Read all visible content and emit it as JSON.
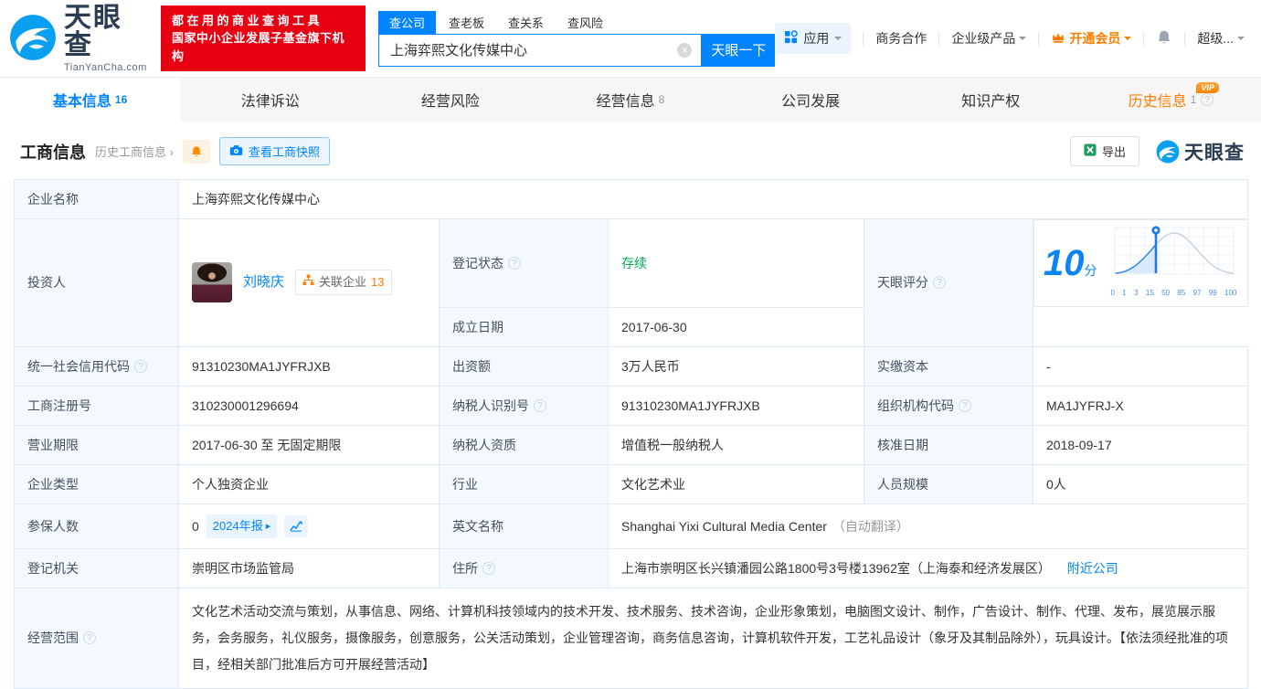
{
  "icons": {
    "help": "?",
    "clear": "×",
    "chevron": "›",
    "report_arrow": "▸"
  },
  "brand": {
    "name_cn": "天眼查",
    "domain": "TianYanCha.com",
    "banner_line1": "都在用的商业查询工具",
    "banner_line2": "国家中小企业发展子基金旗下机构"
  },
  "search": {
    "tabs": [
      {
        "label": "查公司"
      },
      {
        "label": "查老板"
      },
      {
        "label": "查关系"
      },
      {
        "label": "查风险"
      }
    ],
    "value": "上海弈熙文化传媒中心",
    "submit_label": "天眼一下"
  },
  "topnav": {
    "apps": "应用",
    "cooperation": "商务合作",
    "enterprise_products": "企业级产品",
    "vip": "开通会员",
    "account": "超级..."
  },
  "page_tabs": [
    {
      "label": "基本信息",
      "count": "16"
    },
    {
      "label": "法律诉讼",
      "count": ""
    },
    {
      "label": "经营风险",
      "count": ""
    },
    {
      "label": "经营信息",
      "count": "8"
    },
    {
      "label": "公司发展",
      "count": ""
    },
    {
      "label": "知识产权",
      "count": ""
    },
    {
      "label": "历史信息",
      "count": "1",
      "vip_badge": "VIP"
    }
  ],
  "section": {
    "title": "工商信息",
    "history_link": "历史工商信息",
    "snapshot_button": "查看工商快照",
    "export_button": "导出",
    "watermark": "天眼查"
  },
  "info": {
    "company_name": {
      "label": "企业名称",
      "value": "上海弈熙文化传媒中心"
    },
    "investor": {
      "label": "投资人",
      "name": "刘晓庆",
      "related_label": "关联企业",
      "related_count": "13"
    },
    "reg_status": {
      "label": "登记状态",
      "value": "存续"
    },
    "establish_date": {
      "label": "成立日期",
      "value": "2017-06-30"
    },
    "score": {
      "label": "天眼评分",
      "value": "10",
      "unit": "分"
    },
    "credit_code": {
      "label": "统一社会信用代码",
      "value": "91310230MA1JYFRJXB"
    },
    "capital": {
      "label": "出资额",
      "value": "3万人民币"
    },
    "paid_in_capital": {
      "label": "实缴资本",
      "value": "-"
    },
    "reg_number": {
      "label": "工商注册号",
      "value": "310230001296694"
    },
    "taxpayer_id": {
      "label": "纳税人识别号",
      "value": "91310230MA1JYFRJXB"
    },
    "org_code": {
      "label": "组织机构代码",
      "value": "MA1JYFRJ-X"
    },
    "business_term": {
      "label": "营业期限",
      "value": "2017-06-30 至 无固定期限"
    },
    "taxpayer_quality": {
      "label": "纳税人资质",
      "value": "增值税一般纳税人"
    },
    "approve_date": {
      "label": "核准日期",
      "value": "2018-09-17"
    },
    "company_type": {
      "label": "企业类型",
      "value": "个人独资企业"
    },
    "industry": {
      "label": "行业",
      "value": "文化艺术业"
    },
    "staff_size": {
      "label": "人员规模",
      "value": "0人"
    },
    "insured_count": {
      "label": "参保人数",
      "value": "0",
      "report_badge": "2024年报"
    },
    "english_name": {
      "label": "英文名称",
      "value": "Shanghai Yixi Cultural Media Center",
      "note": "（自动翻译）"
    },
    "reg_authority": {
      "label": "登记机关",
      "value": "崇明区市场监管局"
    },
    "address": {
      "label": "住所",
      "value": "上海市崇明区长兴镇潘园公路1800号3号楼13962室（上海泰和经济发展区）",
      "nearby_link": "附近公司"
    },
    "business_scope": {
      "label": "经营范围",
      "value": "文化艺术活动交流与策划，从事信息、网络、计算机科技领域内的技术开发、技术服务、技术咨询，企业形象策划，电脑图文设计、制作，广告设计、制作、代理、发布，展览展示服务，会务服务，礼仪服务，摄像服务，创意服务，公关活动策划，企业管理咨询，商务信息咨询，计算机软件开发，工艺礼品设计（象牙及其制品除外），玩具设计。【依法须经批准的项目，经相关部门批准后方可开展经营活动】"
    }
  },
  "score_chart": {
    "marker_value": 10,
    "axis_labels": [
      "0",
      "1",
      "3",
      "15",
      "50",
      "85",
      "97",
      "99",
      "100"
    ]
  },
  "colors": {
    "primary": "#0084ff",
    "orange": "#ff7d00",
    "green": "#00a854",
    "banner_red": "#e60012"
  }
}
